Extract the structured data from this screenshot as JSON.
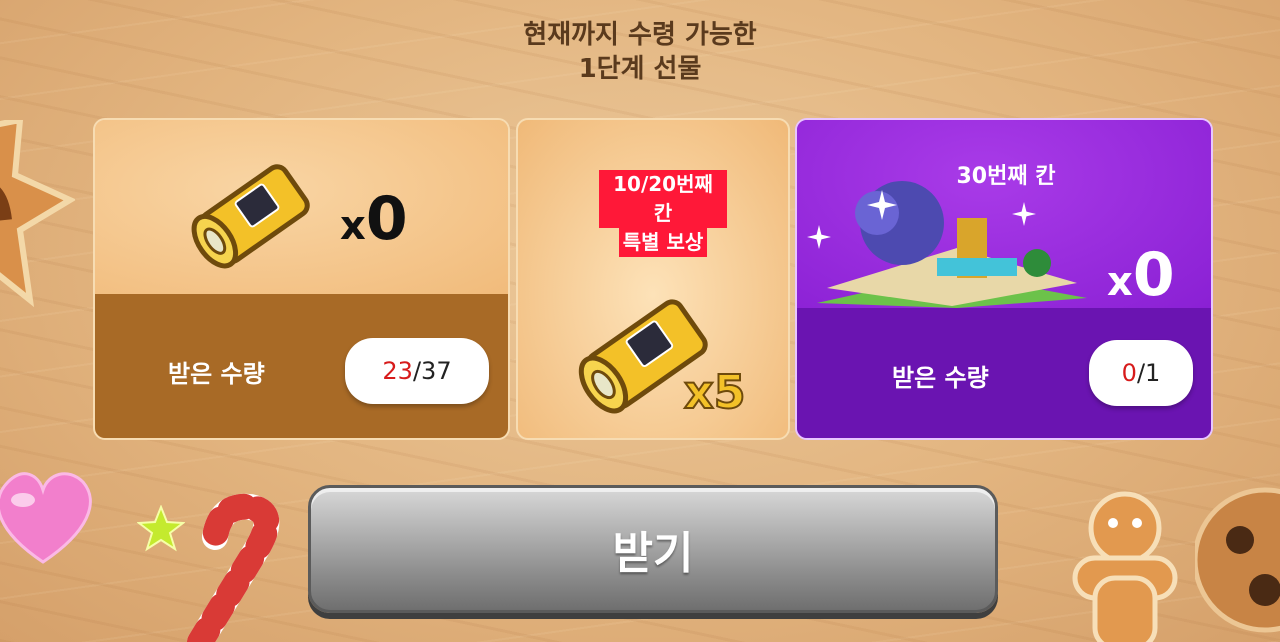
{
  "header": {
    "line1": "현재까지 수령 가능한",
    "line2": "1단계 선물"
  },
  "card_left": {
    "count_prefix": "x",
    "count_value": "0",
    "received_label": "받은 수량",
    "received_current": "23",
    "received_sep": "/",
    "received_total": "37"
  },
  "card_middle": {
    "badge_line1": "10/20번째 칸",
    "badge_line2": "특별 보상",
    "reward_multiplier": "x5"
  },
  "card_right": {
    "title": "30번째 칸",
    "count_prefix": "x",
    "count_value": "0",
    "received_label": "받은 수량",
    "received_current": "0",
    "received_sep": "/",
    "received_total": "1"
  },
  "claim_button": {
    "label": "받기"
  },
  "colors": {
    "accent_red": "#ff1838",
    "count_red": "#d71b1b",
    "purple": "#8a22d6",
    "brown": "#a86a26"
  },
  "icons": [
    "scroll-icon",
    "scroll-bundle-icon",
    "garden-island-image",
    "sparkle-icon",
    "cookie-decoration",
    "candy-heart-decoration",
    "candy-cane-decoration",
    "gingerbread-decoration",
    "star-decoration"
  ]
}
